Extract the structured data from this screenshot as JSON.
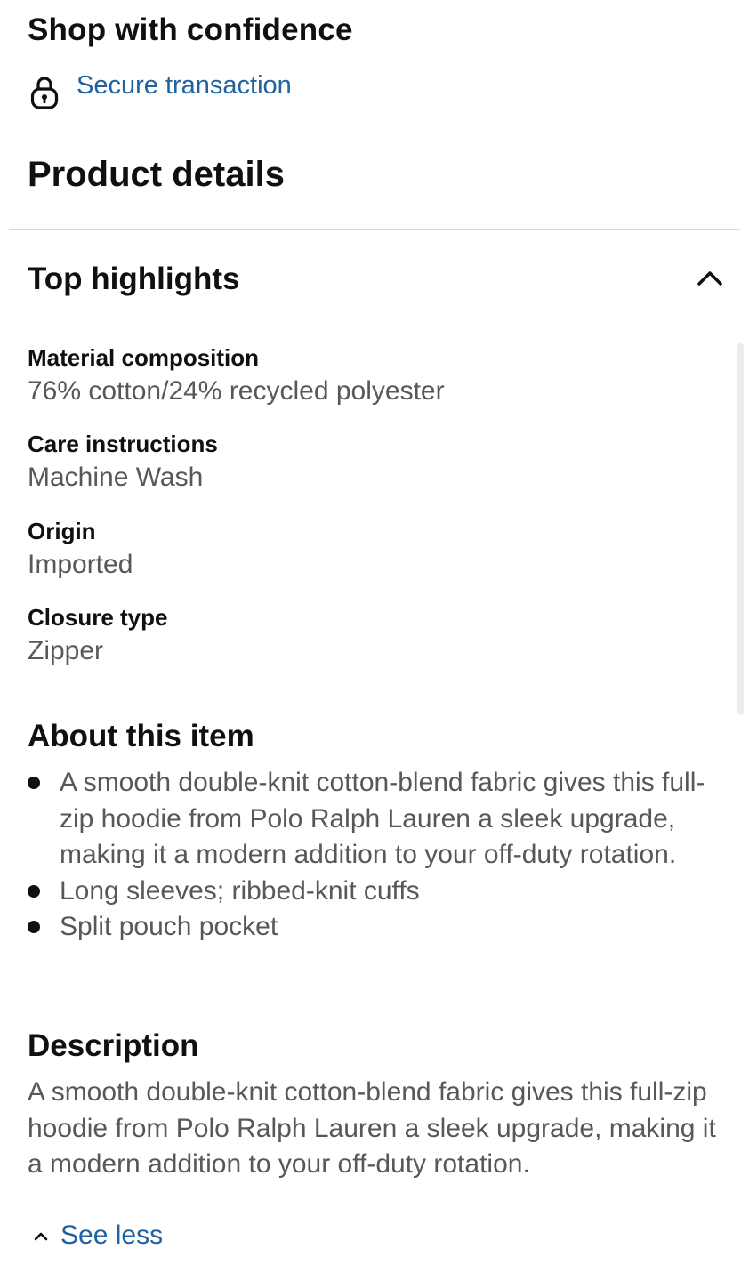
{
  "shop": {
    "heading": "Shop with confidence",
    "secure_link": "Secure transaction"
  },
  "product_details": {
    "heading": "Product details"
  },
  "top_highlights": {
    "heading": "Top highlights",
    "toggle_icon": "chevron-up-icon",
    "items": [
      {
        "label": "Material composition",
        "value": "76% cotton/24% recycled polyester"
      },
      {
        "label": "Care instructions",
        "value": "Machine Wash"
      },
      {
        "label": "Origin",
        "value": "Imported"
      },
      {
        "label": "Closure type",
        "value": "Zipper"
      }
    ]
  },
  "about": {
    "heading": "About this item",
    "bullets": [
      "A smooth double-knit cotton-blend fabric gives this full-zip hoodie from Polo Ralph Lauren a sleek upgrade, making it a modern addition to your off-duty rotation.",
      "Long sleeves; ribbed-knit cuffs",
      "Split pouch pocket"
    ]
  },
  "description": {
    "heading": "Description",
    "text": "A smooth double-knit cotton-blend fabric gives this full-zip hoodie from Polo Ralph Lauren a sleek upgrade, making it a modern addition to your off-duty rotation.",
    "see_less": "See less"
  },
  "colors": {
    "link": "#2162a1",
    "heading_text": "#0f1111",
    "body_text": "#565959",
    "divider": "#d5d9d9"
  }
}
